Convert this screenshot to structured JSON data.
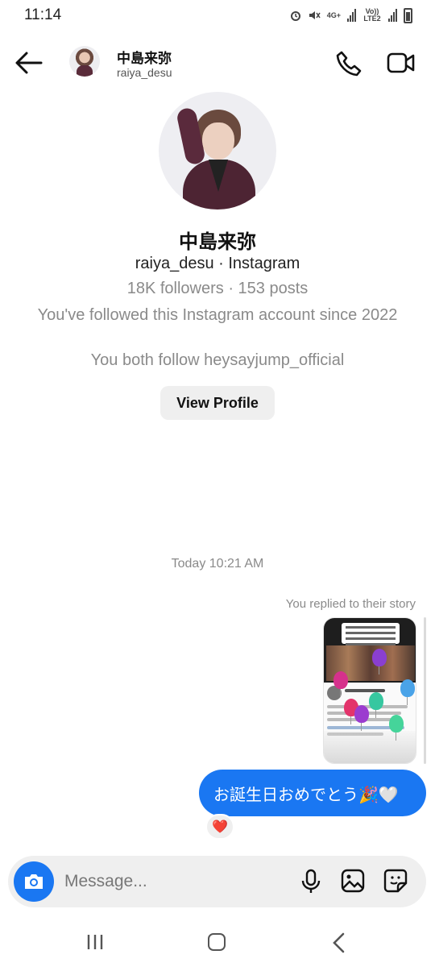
{
  "status_bar": {
    "time": "11:14",
    "net_label_1": "4G+",
    "net_label_2": "Vo)) LTE2"
  },
  "header": {
    "name": "中島来弥",
    "username": "raiya_desu"
  },
  "profile": {
    "name": "中島来弥",
    "handle_line": "raiya_desu · Instagram",
    "stats_line": "18K followers · 153 posts",
    "since_line": "You've followed this Instagram account since 2022",
    "mutual_line": "You both follow heysayjump_official",
    "view_profile_label": "View Profile"
  },
  "chat": {
    "timestamp": "Today 10:21 AM",
    "reply_note": "You replied to their story",
    "message_text": "お誕生日おめでとう🎉🤍",
    "reaction": "❤️"
  },
  "composer": {
    "placeholder": "Message..."
  },
  "colors": {
    "accent": "#1a77f2",
    "secondary_text": "#8a8a8a",
    "bubble_text": "#ffffff"
  },
  "icons": [
    "back-arrow-icon",
    "phone-icon",
    "video-camera-icon",
    "camera-icon",
    "microphone-icon",
    "gallery-icon",
    "sticker-icon",
    "heart-icon",
    "recent-apps-icon",
    "home-icon",
    "nav-back-icon"
  ]
}
